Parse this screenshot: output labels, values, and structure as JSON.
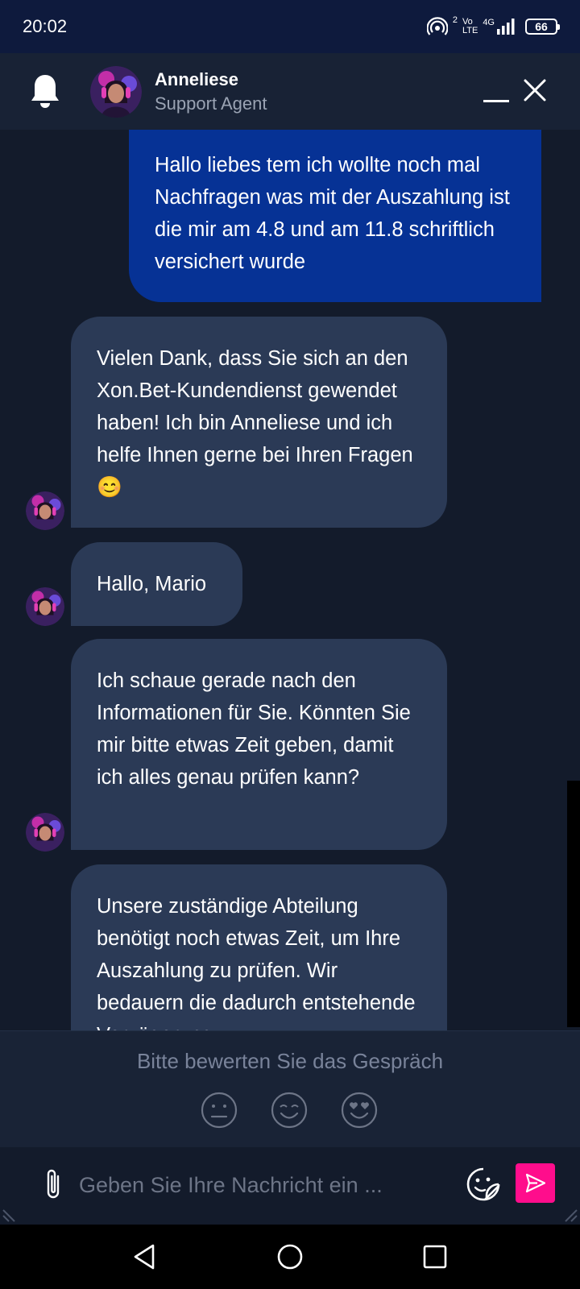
{
  "status_bar": {
    "time": "20:02",
    "signal_label_top": "Vo",
    "signal_label_bottom": "LTE",
    "network": "4G",
    "sim": "2",
    "battery": "66"
  },
  "header": {
    "agent_name": "Anneliese",
    "agent_role": "Support Agent"
  },
  "messages": [
    {
      "from": "user",
      "text": "Hallo liebes tem ich wollte noch mal Nachfragen was mit der Auszahlung ist die mir am 4.8 und am 11.8 schriftlich versichert wurde"
    },
    {
      "from": "agent",
      "text": "Vielen Dank, dass Sie sich an den Xon.Bet-Kundendienst gewendet haben! Ich bin Anneliese und ich helfe Ihnen gerne bei Ihren Fragen 😊"
    },
    {
      "from": "agent",
      "text": "Hallo, Mario"
    },
    {
      "from": "agent",
      "text": "Ich schaue gerade nach den Informationen für Sie. Könnten Sie mir bitte etwas Zeit geben, damit ich alles genau prüfen kann?"
    },
    {
      "from": "agent",
      "text": "Unsere zuständige Abteilung benötigt noch etwas Zeit, um Ihre Auszahlung zu prüfen. Wir bedauern die dadurch entstehende Verzögerung."
    }
  ],
  "rating": {
    "prompt": "Bitte bewerten Sie das Gespräch",
    "options": [
      "neutral-face-icon",
      "smiling-face-icon",
      "heart-eyes-face-icon"
    ]
  },
  "composer": {
    "placeholder": "Geben Sie Ihre Nachricht ein ..."
  },
  "colors": {
    "status_bar_bg": "#0e1a3d",
    "header_bg": "#182235",
    "chat_bg": "#131b2b",
    "user_bubble": "#063295",
    "agent_bubble": "#2b3a56",
    "send_button": "#ff0d8c"
  },
  "icons": {
    "header_left": "bell-icon",
    "header_right": [
      "minimize-icon",
      "close-icon"
    ],
    "composer_left": "paperclip-icon",
    "composer_right": [
      "sticker-icon",
      "send-icon"
    ],
    "nav": [
      "back-icon",
      "home-icon",
      "recents-icon"
    ]
  }
}
